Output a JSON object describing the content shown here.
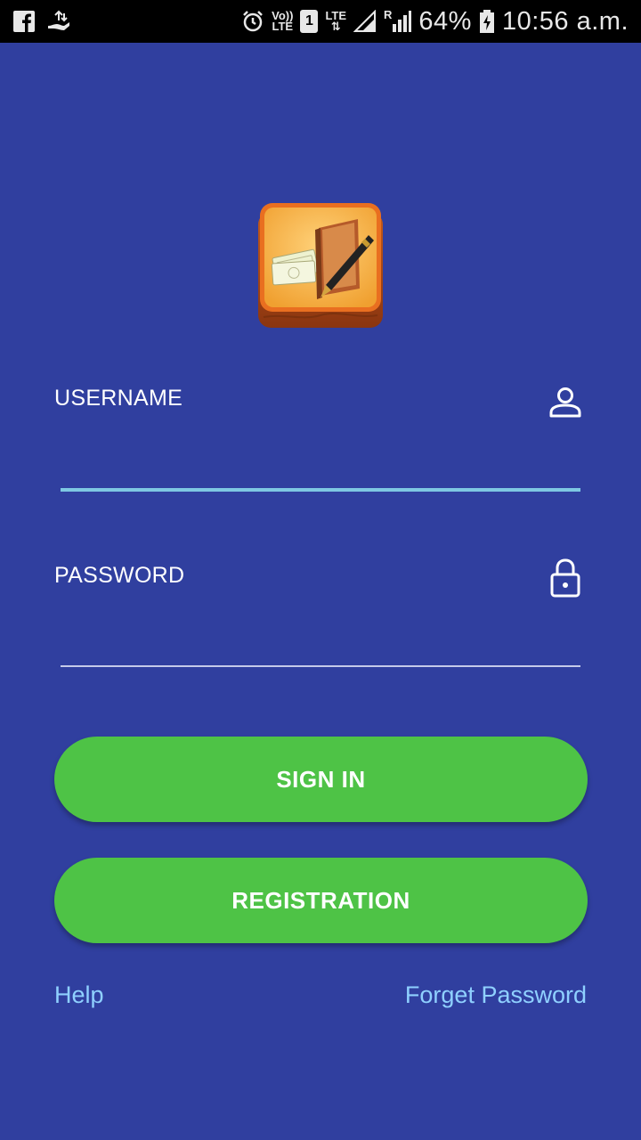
{
  "status_bar": {
    "volte_top": "Vo))",
    "volte_bottom": "LTE",
    "sim_number": "1",
    "lte_label": "LTE",
    "roaming_label": "R",
    "battery": "64%",
    "time": "10:56 a.m."
  },
  "login": {
    "username_label": "USERNAME",
    "username_value": "",
    "password_label": "PASSWORD",
    "password_value": "",
    "sign_in_label": "SIGN IN",
    "registration_label": "REGISTRATION",
    "help_label": "Help",
    "forget_password_label": "Forget Password"
  },
  "colors": {
    "background": "#303f9f",
    "button": "#4ec346",
    "link": "#8fd0ff",
    "username_underline": "#7ec8e3",
    "password_underline": "#c5cae9"
  },
  "icons": {
    "username": "person-icon",
    "password": "lock-icon",
    "logo": "app-logo-book-money-pen"
  }
}
